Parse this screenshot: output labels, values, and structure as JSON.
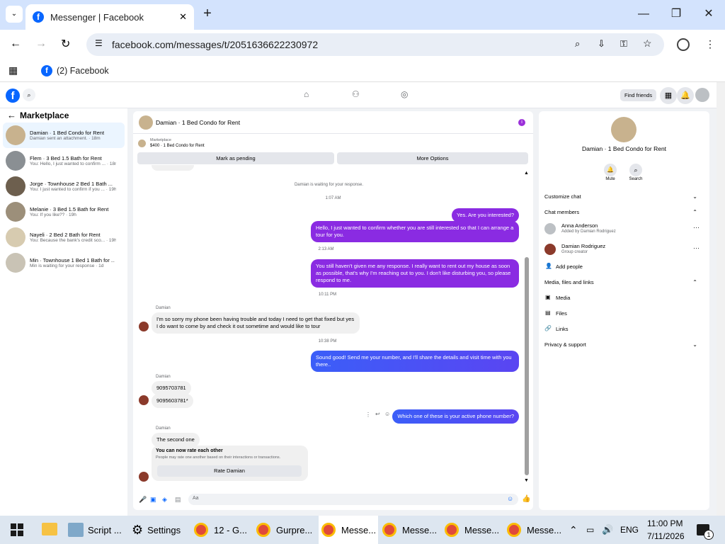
{
  "browser": {
    "tab_title": "Messenger | Facebook",
    "url": "facebook.com/messages/t/2051636622230972",
    "bookmark": "(2) Facebook"
  },
  "fb": {
    "find_friends": "Find friends"
  },
  "sidebar": {
    "title": "Marketplace",
    "items": [
      {
        "name": "Damian · 1 Bed Condo for Rent",
        "sub": "Damian sent an attachment. · 18m"
      },
      {
        "name": "Flem · 3 Bed 1.5 Bath for Rent",
        "sub": "You: Hello, I just wanted to confirm ... · 18m"
      },
      {
        "name": "Jorge · Townhouse 2 Bed 1 Bath ...",
        "sub": "You: I just wanted to confirm if you ... · 19h"
      },
      {
        "name": "Melanie · 3 Bed 1.5 Bath for Rent",
        "sub": "You: If you like?? · 19h"
      },
      {
        "name": "Nayeli · 2 Bed 2 Bath for Rent",
        "sub": "You: Because the bank's credit sco... · 19h"
      },
      {
        "name": "Min · Townhouse 1 Bed 1 Bath for ...",
        "sub": "Min is waiting for your response · 1d"
      }
    ]
  },
  "chat": {
    "header": "Damian · 1 Bed Condo for Rent",
    "listing_label": "Marketplace",
    "listing": "$400 · 1 Bed Condo for Rent",
    "mark_pending": "Mark as pending",
    "more_options": "More Options",
    "waiting": "Damian is waiting for your response.",
    "messages": {
      "t1": "1:07 AM",
      "m1": "Yes. Are you interested?",
      "m2": "Hello, I just wanted to confirm whether you are still interested so that I can arrange a tour for you.",
      "t2": "2:13 AM",
      "m3": "You still haven't given me any response. I really want to rent out my house as soon as possible, that's why I'm reaching out to you. I don't like disturbing you, so please respond to me.",
      "t3": "10:11 PM",
      "sender": "Damian",
      "m4": "I'm so sorry my phone been having trouble and today I need to get that fixed but yes I do want to come by and check it out sometime and would like to tour",
      "t4": "10:38 PM",
      "m5": "Sound good! Send me your number, and I'll share the details and visit time with you there..",
      "m6": "9095703781",
      "m7": "9095603781*",
      "m8": "Which one of these is your active phone number?",
      "m9": "The second one",
      "rate_title": "You can now rate each other",
      "rate_sub": "People may rate one another based on their interactions or transactions.",
      "rate_button": "Rate Damian"
    },
    "input_placeholder": "Aa"
  },
  "details": {
    "title": "Damian · 1 Bed Condo for Rent",
    "mute": "Mute",
    "search": "Search",
    "customize": "Customize chat",
    "members": "Chat members",
    "member1": {
      "name": "Anna Anderson",
      "sub": "Added by Damian Rodriguez"
    },
    "member2": {
      "name": "Damian Rodriguez",
      "sub": "Group creator"
    },
    "add_people": "Add people",
    "media_header": "Media, files and links",
    "media": "Media",
    "files": "Files",
    "links": "Links",
    "privacy": "Privacy & support"
  },
  "taskbar": {
    "items": [
      "Script ...",
      "Settings",
      "12 - G...",
      "Gurpre...",
      "Messe...",
      "Messe...",
      "Messe...",
      "Messe..."
    ],
    "lang": "ENG",
    "time": "11:00 PM",
    "date": "7/11/2026",
    "notif": "1"
  }
}
